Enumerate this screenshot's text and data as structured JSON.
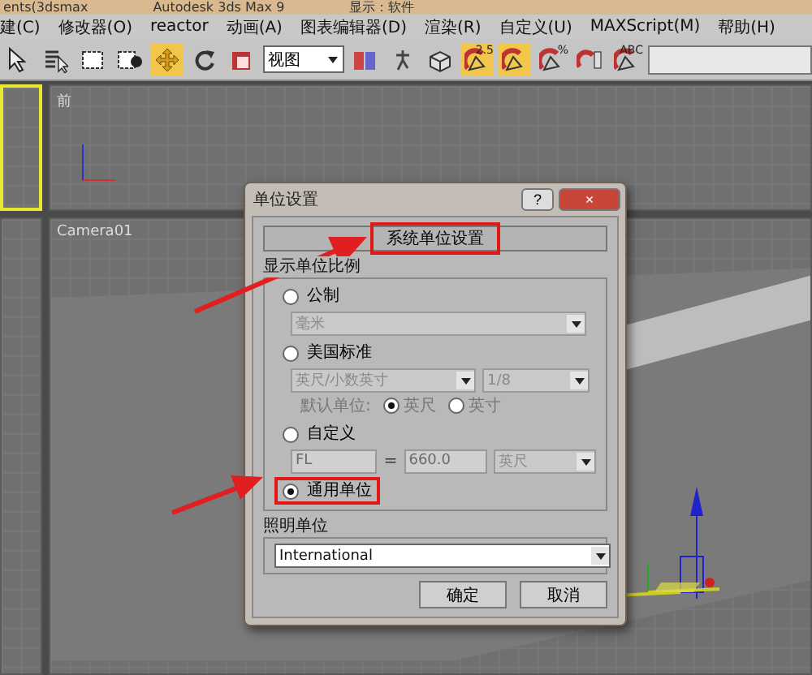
{
  "title_bar": {
    "texts": [
      "ents(3dsmax",
      "Autodesk 3ds Max 9",
      "显示：软件"
    ]
  },
  "menu_bar": [
    "建(C)",
    "修改器(O)",
    "reactor",
    "动画(A)",
    "图表编辑器(D)",
    "渲染(R)",
    "自定义(U)",
    "MAXScript(M)",
    "帮助(H)"
  ],
  "toolbar": {
    "tools_left": [
      {
        "kind": "select",
        "selected": false
      },
      {
        "kind": "select-name",
        "selected": false
      },
      {
        "kind": "rect-region",
        "selected": false
      },
      {
        "kind": "window",
        "selected": false
      },
      {
        "kind": "move",
        "selected": true
      },
      {
        "kind": "rotate",
        "selected": false
      },
      {
        "kind": "scale",
        "selected": false
      }
    ],
    "view_dropdown": "视图",
    "tools_right": [
      {
        "kind": "pivot",
        "selected": false
      },
      {
        "kind": "figure",
        "selected": false
      },
      {
        "kind": "teapot",
        "selected": false
      },
      {
        "kind": "snap",
        "selected": true,
        "label": "2.5"
      },
      {
        "kind": "angle-snap",
        "selected": true
      },
      {
        "kind": "percent-snap",
        "selected": false,
        "label": "%"
      },
      {
        "kind": "spinner-snap",
        "selected": false
      },
      {
        "kind": "named-set",
        "selected": false,
        "label": "ABC"
      }
    ]
  },
  "viewports": [
    {
      "kind": "blank",
      "active": true
    },
    {
      "kind": "front",
      "label": "前",
      "active": false
    },
    {
      "kind": "blank",
      "active": false
    },
    {
      "kind": "camera",
      "label": "Camera01",
      "active": false
    }
  ],
  "dialog": {
    "title": "单位设置",
    "help_button": "?",
    "close_button": "×",
    "system_button": {
      "label": "系统单位设置",
      "highlighted": true
    },
    "display_group": {
      "title": "显示单位比例",
      "options": [
        {
          "kind": "metric",
          "label": "公制",
          "selected": false,
          "highlighted": false,
          "dropdown": {
            "value": "毫米",
            "disabled": true
          }
        },
        {
          "kind": "us",
          "label": "美国标准",
          "selected": false,
          "highlighted": false,
          "dropdowns": [
            {
              "value": "英尺/小数英寸",
              "disabled": true
            },
            {
              "value": "1/8",
              "disabled": true
            }
          ],
          "default_unit": {
            "label": "默认单位:",
            "choices": [
              {
                "label": "英尺",
                "selected": true
              },
              {
                "label": "英寸",
                "selected": false
              }
            ]
          }
        },
        {
          "kind": "custom",
          "label": "自定义",
          "selected": false,
          "highlighted": false,
          "name_field": {
            "value": "FL",
            "disabled": true
          },
          "equals": "=",
          "amount_field": {
            "value": "660.0",
            "disabled": true
          },
          "unit_dropdown": {
            "value": "英尺",
            "disabled": true
          }
        },
        {
          "kind": "generic",
          "label": "通用单位",
          "selected": true,
          "highlighted": true
        }
      ]
    },
    "lighting_group": {
      "title": "照明单位",
      "dropdown": {
        "value": "International",
        "disabled": false
      }
    },
    "buttons": [
      "确定",
      "取消"
    ]
  }
}
